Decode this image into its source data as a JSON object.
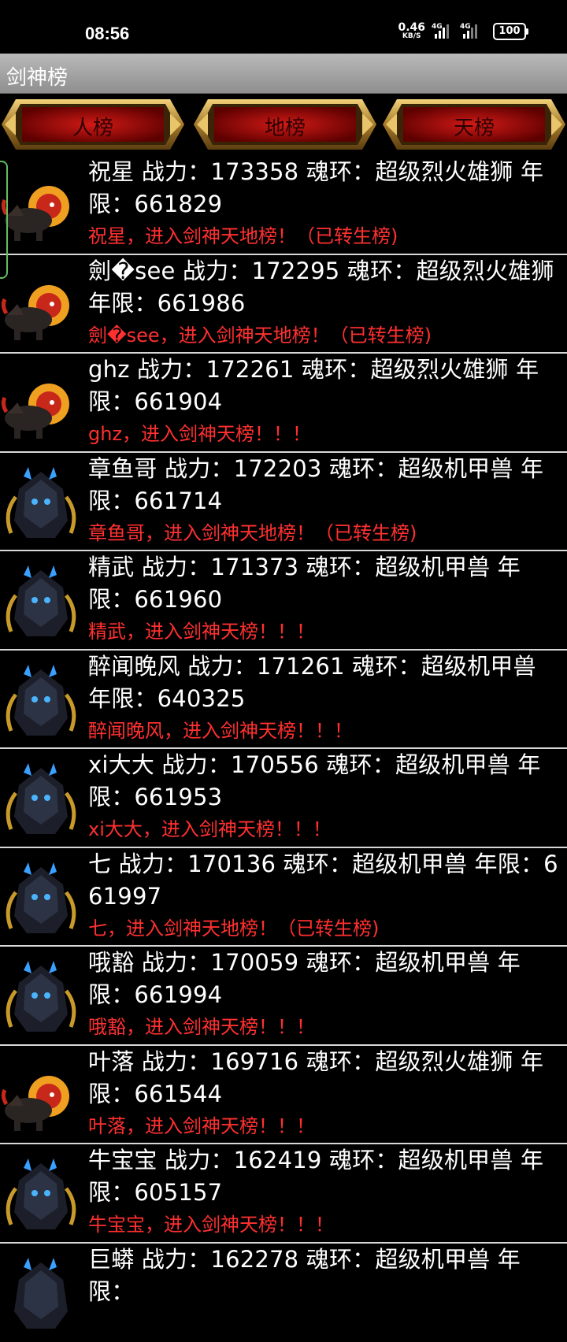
{
  "status_bar": {
    "time": "08:56",
    "net_speed_value": "0.46",
    "net_speed_unit": "KB/S",
    "signal_1_label": "4G",
    "signal_2_label": "4G",
    "battery": "100"
  },
  "app": {
    "title": "剑神榜"
  },
  "tabs": [
    {
      "label": "人榜"
    },
    {
      "label": "地榜"
    },
    {
      "label": "天榜"
    }
  ],
  "rank_rows": [
    {
      "pet": "lion-pet-icon",
      "main": "祝星 战力：173358 魂环：超级烈火雄狮 年限：661829",
      "announce": "祝星，进入剑神天地榜！（已转生榜)"
    },
    {
      "pet": "lion-pet-icon",
      "main": "劍�see 战力：172295 魂环：超级烈火雄狮 年限：661986",
      "announce": "劍�see，进入剑神天地榜！（已转生榜)"
    },
    {
      "pet": "lion-pet-icon",
      "main": "ghz 战力：172261 魂环：超级烈火雄狮 年限：661904",
      "announce": "ghz，进入剑神天榜！！！"
    },
    {
      "pet": "mech-pet-icon",
      "main": "章鱼哥 战力：172203 魂环：超级机甲兽 年限：661714",
      "announce": "章鱼哥，进入剑神天地榜！（已转生榜)"
    },
    {
      "pet": "mech-pet-icon",
      "main": "精武 战力：171373 魂环：超级机甲兽 年限：661960",
      "announce": "精武，进入剑神天榜！！！"
    },
    {
      "pet": "mech-pet-icon",
      "main": "醉闻晚风 战力：171261 魂环：超级机甲兽 年限：640325",
      "announce": "醉闻晚风，进入剑神天榜！！！"
    },
    {
      "pet": "mech-pet-icon",
      "main": "xi大大 战力：170556 魂环：超级机甲兽 年限：661953",
      "announce": "xi大大，进入剑神天榜！！！"
    },
    {
      "pet": "mech-pet-icon",
      "main": "七 战力：170136 魂环：超级机甲兽 年限：661997",
      "announce": "七，进入剑神天地榜！（已转生榜)"
    },
    {
      "pet": "mech-pet-icon",
      "main": "哦豁 战力：170059 魂环：超级机甲兽 年限：661994",
      "announce": "哦豁，进入剑神天榜！！！"
    },
    {
      "pet": "lion-pet-icon",
      "main": "叶落 战力：169716 魂环：超级烈火雄狮 年限：661544",
      "announce": "叶落，进入剑神天榜！！！"
    },
    {
      "pet": "mech-pet-icon",
      "main": "牛宝宝 战力：162419 魂环：超级机甲兽 年限：605157",
      "announce": "牛宝宝，进入剑神天榜！！！"
    },
    {
      "pet": "mech-pet-icon",
      "main": "巨蟒 战力：162278 魂环：超级机甲兽 年限：",
      "announce": ""
    }
  ]
}
